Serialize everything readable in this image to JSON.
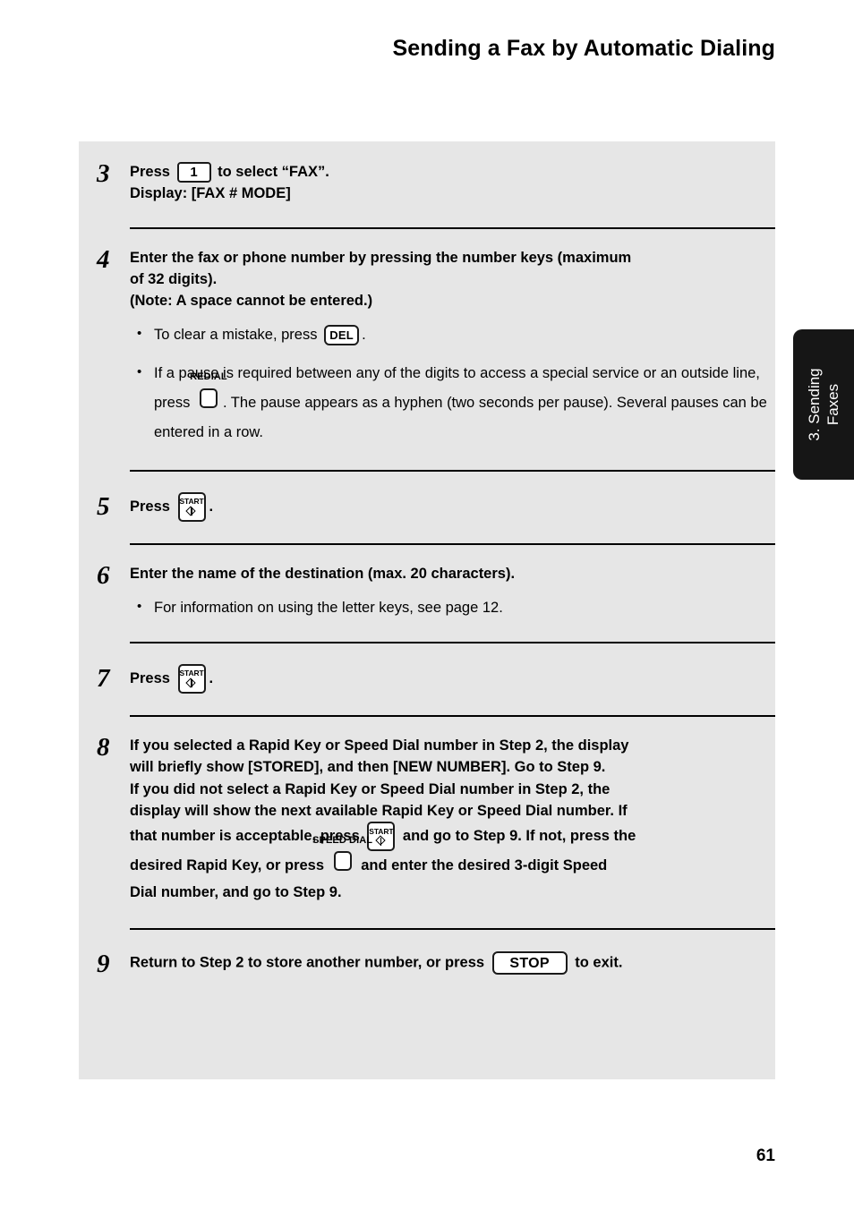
{
  "header": {
    "title": "Sending a Fax by Automatic Dialing"
  },
  "side_tab": {
    "line1": "3. Sending",
    "line2": "Faxes",
    "background_color": "#161616",
    "text_color": "#ffffff"
  },
  "panel": {
    "background_color": "#e6e6e6"
  },
  "keys": {
    "one": "1",
    "del": "DEL",
    "redial_label": "REDIAL",
    "speed_dial_label": "SPEED DIAL",
    "start_label": "START",
    "stop": "STOP"
  },
  "steps": [
    {
      "number": "3",
      "lines": [
        {
          "before": "Press ",
          "key": "one",
          "after": " to select “FAX”."
        },
        {
          "before": "Display: [FAX # MODE]"
        }
      ]
    },
    {
      "number": "4",
      "lines": [
        {
          "before": "Enter the fax or phone number by pressing the number keys (maximum"
        },
        {
          "before": "of 32 digits)."
        },
        {
          "before": "(Note: A space cannot be entered.)"
        }
      ],
      "bullets": [
        {
          "before": "To clear a mistake, press ",
          "key": "del",
          "after": "."
        },
        {
          "before": "If a pause is required between any of the digits to access a special service or an outside line, press ",
          "key": "redial",
          "after": ". The pause appears as a hyphen (two seconds per pause). Several pauses can be entered in a row."
        }
      ]
    },
    {
      "number": "5",
      "lines": [
        {
          "before": "Press ",
          "key": "start",
          "after": "."
        }
      ]
    },
    {
      "number": "6",
      "lines": [
        {
          "before": "Enter the name of the destination (max. 20 characters)."
        }
      ],
      "bullets": [
        {
          "before": "For information on using the letter keys, see page 12."
        }
      ]
    },
    {
      "number": "7",
      "lines": [
        {
          "before": "Press ",
          "key": "start",
          "after": "."
        }
      ]
    },
    {
      "number": "8",
      "lines": [
        {
          "before": "If you  selected a Rapid Key or Speed Dial number in Step 2, the display"
        },
        {
          "before": "will briefly show [STORED], and then [NEW NUMBER]. Go to Step 9."
        },
        {
          "before": "If you did not select a Rapid Key or Speed Dial number in Step 2, the"
        },
        {
          "before": "display will show the next available Rapid Key or Speed Dial number. If"
        },
        {
          "before": "that number is acceptable, press ",
          "key": "start",
          "after": " and go to Step 9. If not, press the"
        },
        {
          "before": "desired Rapid Key, or press ",
          "key": "speed_dial",
          "after": " and enter the desired 3-digit Speed"
        },
        {
          "before": "Dial number, and go to Step 9."
        }
      ]
    },
    {
      "number": "9",
      "lines": [
        {
          "before": "Return to Step 2 to store another number, or press ",
          "key": "stop",
          "after": " to exit."
        }
      ]
    }
  ],
  "footer": {
    "page_number": "61"
  }
}
